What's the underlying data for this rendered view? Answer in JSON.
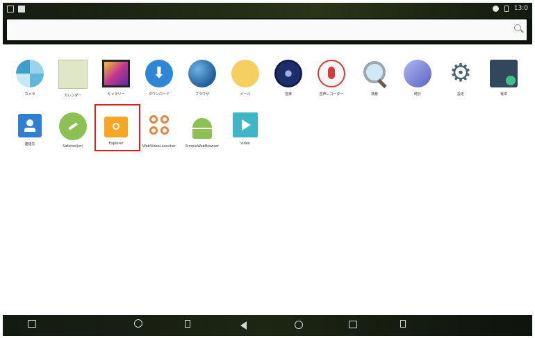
{
  "statusbar": {
    "time": "13:0"
  },
  "apps": [
    {
      "id": "camera",
      "label": "カメラ",
      "color": "#7fc9e0"
    },
    {
      "id": "calendar",
      "label": "カレンダー",
      "color": "#c9d6a2"
    },
    {
      "id": "gallery",
      "label": "ギャラリー",
      "color": "#9a4fa8"
    },
    {
      "id": "download",
      "label": "ダウンロード",
      "color": "#2d86d6"
    },
    {
      "id": "browser",
      "label": "ブラウザ",
      "color": "#2f6fb0"
    },
    {
      "id": "email",
      "label": "メール",
      "color": "#f3c64a"
    },
    {
      "id": "music",
      "label": "音楽",
      "color": "#1d2d6b"
    },
    {
      "id": "recorder",
      "label": "音声レコーダー",
      "color": "#d83a3a"
    },
    {
      "id": "search",
      "label": "検索",
      "color": "#7cc6e8"
    },
    {
      "id": "clock",
      "label": "時計",
      "color": "#7c86d8"
    },
    {
      "id": "settings",
      "label": "設定",
      "color": "#4b6470"
    },
    {
      "id": "calculator",
      "label": "電卓",
      "color": "#30485a"
    },
    {
      "id": "contacts",
      "label": "連絡先",
      "color": "#2f7fd3"
    },
    {
      "id": "sdkmanager",
      "label": "Safetool(er)",
      "color": "#8cc152"
    },
    {
      "id": "explorer",
      "label": "Explorer",
      "color": "#f5a623"
    },
    {
      "id": "webvideo",
      "label": "WebVideoLauncher",
      "color": "#e8833a"
    },
    {
      "id": "simpleweb",
      "label": "SimpleWebBrowser",
      "color": "#8cc152"
    },
    {
      "id": "video",
      "label": "Video",
      "color": "#3fb6c8"
    }
  ]
}
